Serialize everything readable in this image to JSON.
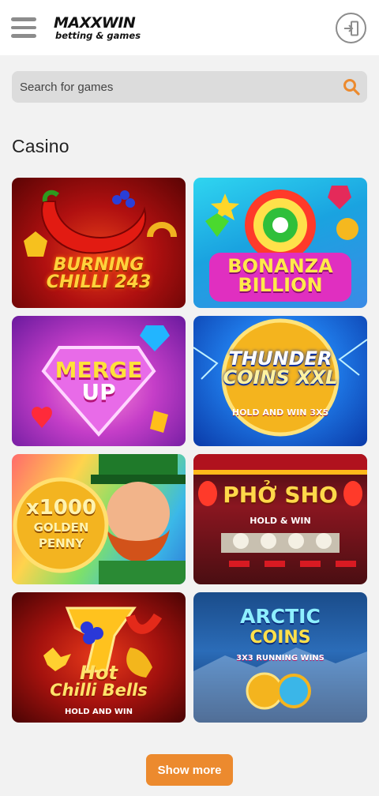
{
  "header": {
    "logo_main": "MAXXWIN",
    "logo_sub": "betting & games",
    "menu_icon": "hamburger-menu-icon",
    "login_icon": "login-door-icon"
  },
  "search": {
    "placeholder": "Search for games",
    "icon": "search-icon"
  },
  "section": {
    "title": "Casino"
  },
  "games": [
    {
      "title_line1": "BURNING",
      "title_line2": "CHILLI 243"
    },
    {
      "title_line1": "BONANZA",
      "title_line2": "BILLION"
    },
    {
      "title_line1": "MERGE",
      "title_line2": "UP"
    },
    {
      "title_line1": "THUNDER",
      "title_line2": "COINS XXL",
      "subtitle": "HOLD AND WIN 3X5"
    },
    {
      "title_line1": "x1000",
      "title_line2": "GOLDEN PENNY"
    },
    {
      "title_line1": "PHỞ SHO",
      "subtitle": "HOLD & WIN"
    },
    {
      "title_line1": "Hot",
      "title_line2": "Chilli Bells",
      "subtitle": "HOLD AND WIN"
    },
    {
      "title_line1": "ARCTIC",
      "title_line2": "COINS",
      "subtitle": "3X3 RUNNING WINS"
    }
  ],
  "footer": {
    "show_more_label": "Show more"
  },
  "colors": {
    "accent": "#ec8a2e",
    "header_bg": "#ffffff",
    "page_bg": "#f2f2f2",
    "search_bg": "#dcdcdc"
  }
}
